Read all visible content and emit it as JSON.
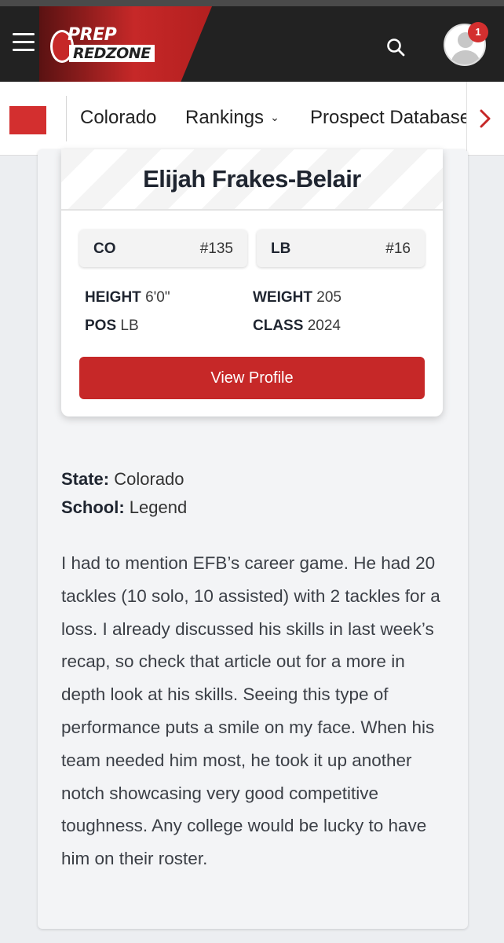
{
  "header": {
    "logo_prep": "PREP",
    "logo_redzone": "REDZONE",
    "notification_count": "1"
  },
  "subnav": {
    "items": [
      {
        "label": "Colorado"
      },
      {
        "label": "Rankings",
        "chevron": "⌄"
      },
      {
        "label": "Prospect Database"
      }
    ]
  },
  "player": {
    "name": "Elijah Frakes-Belair",
    "state_rank": {
      "label": "CO",
      "value": "#135"
    },
    "position_rank": {
      "label": "LB",
      "value": "#16"
    },
    "height": {
      "label": "HEIGHT",
      "value": "6'0\""
    },
    "weight": {
      "label": "WEIGHT",
      "value": "205"
    },
    "pos": {
      "label": "POS",
      "value": "LB"
    },
    "class": {
      "label": "CLASS",
      "value": "2024"
    },
    "view_profile_label": "View Profile"
  },
  "details": {
    "state_label": "State:",
    "state_value": "Colorado",
    "school_label": "School:",
    "school_value": "Legend"
  },
  "description": "I had to mention EFB’s career game. He had 20 tackles (10 solo, 10 assisted) with 2 tackles for a loss. I already discussed his skills in last week’s recap, so check that article out for a more in depth look at his skills. Seeing this type of performance puts a smile on my face. When his team needed him most, he took it up another notch showcasing very good competitive toughness. Any college would be lucky to have him on their roster.",
  "colors": {
    "brand_red": "#c62828",
    "header_bg": "#222222"
  }
}
